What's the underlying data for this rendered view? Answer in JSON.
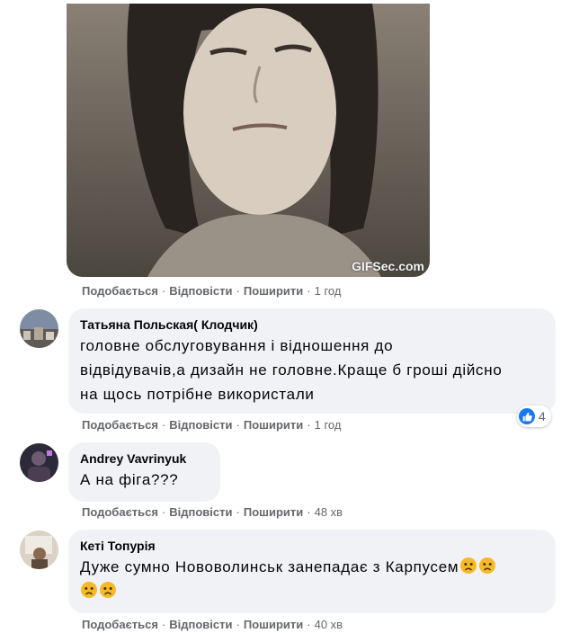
{
  "gif": {
    "watermark": "GIFSec.com"
  },
  "actions": {
    "like": "Подобається",
    "reply": "Відповісти",
    "share": "Поширити",
    "separator": "·"
  },
  "comments": [
    {
      "time": "1 год"
    },
    {
      "author": "Татьяна Польская( Клодчик)",
      "lines": [
        "головне обслуговування і відношення до",
        "відвідувачів,а дизайн не головне.Краще б гроші дійсно",
        "на щось потрібне використали"
      ],
      "time": "1 год",
      "reaction_count": "4"
    },
    {
      "author": "Andrey Vavrinyuk",
      "lines": [
        "А на фіга???"
      ],
      "time": "48 хв"
    },
    {
      "author": "Кеті Топурія",
      "lines": [
        "Дуже сумно Нововолинськ занепадає з Карпусем"
      ],
      "time": "40 хв"
    }
  ],
  "icons": {
    "like": "like-icon",
    "emoji": "sad-face-emoji"
  },
  "colors": {
    "bubble": "#f0f2f5",
    "meta": "#65676b",
    "like_blue": "#1877f2"
  }
}
